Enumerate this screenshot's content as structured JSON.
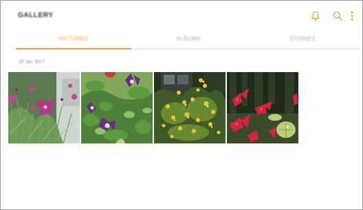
{
  "app": {
    "title": "GALLERY"
  },
  "toolbar": {
    "icons": [
      "bell-icon",
      "search-icon",
      "more-vert-icon"
    ],
    "accent_color": "#f29d33"
  },
  "tabs": [
    {
      "label": "PICTURES",
      "selected": true
    },
    {
      "label": "ALBUMS",
      "selected": false
    },
    {
      "label": "STORIES",
      "selected": false
    }
  ],
  "section": {
    "date_label": "20 Jan 2017"
  },
  "photos": [
    {
      "subject": "pink-flowers"
    },
    {
      "subject": "purple-columbine"
    },
    {
      "subject": "yellow-shrub"
    },
    {
      "subject": "red-leaves"
    }
  ]
}
